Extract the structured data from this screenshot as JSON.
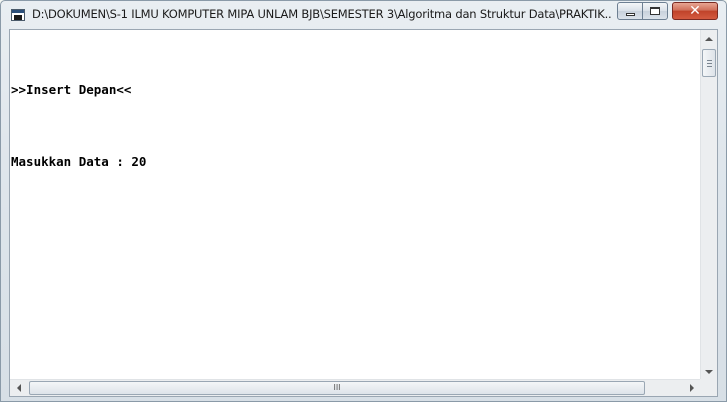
{
  "window": {
    "title": "D:\\DOKUMEN\\S-1 ILMU KOMPUTER MIPA UNLAM BJB\\SEMESTER 3\\Algoritma dan Struktur Data\\PRAKTIK...",
    "icons": {
      "app": "console-app-icon",
      "minimize": "minimize-icon",
      "maximize": "maximize-icon",
      "close": "close-icon"
    },
    "close_glyph": "✕"
  },
  "console": {
    "lines": [
      ">>Insert Depan<<",
      "Masukkan Data : 20"
    ]
  },
  "scrollbars": {
    "horizontal_grip": "III"
  },
  "colors": {
    "console_bg": "#ffffff",
    "console_text": "#000000",
    "close_button": "#c0432a"
  }
}
